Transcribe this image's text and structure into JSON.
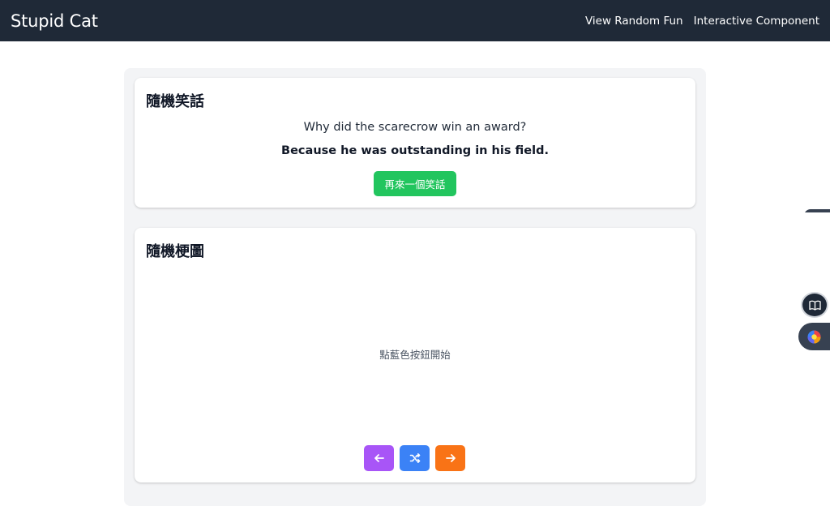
{
  "navbar": {
    "brand": "Stupid Cat",
    "links": [
      "View Random Fun",
      "Interactive Component"
    ]
  },
  "joke_card": {
    "title": "隨機笑話",
    "setup": "Why did the scarecrow win an award?",
    "punchline": "Because he was outstanding in his field.",
    "button_label": "再來一個笑話"
  },
  "meme_card": {
    "title": "隨機梗圖",
    "hint": "點藍色按鈕開始",
    "controls": [
      {
        "name": "previous",
        "icon": "arrow-left-icon",
        "color": "#a855f7"
      },
      {
        "name": "random",
        "icon": "shuffle-icon",
        "color": "#3b82f6"
      },
      {
        "name": "next",
        "icon": "arrow-right-icon",
        "color": "#f97316"
      }
    ]
  },
  "floating_sidebar": {
    "icons": [
      "book-icon",
      "extension-icon"
    ]
  },
  "colors": {
    "navbar_bg": "#1f2937",
    "joke_button": "#22c55e",
    "container_bg": "#f3f4f6"
  }
}
